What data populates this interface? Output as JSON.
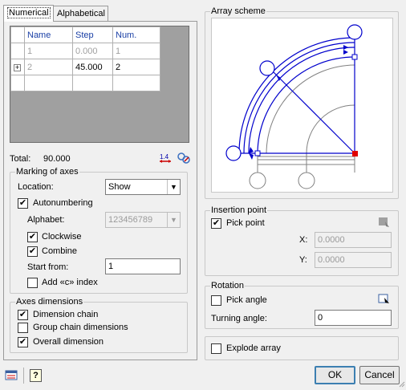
{
  "tabs": [
    {
      "label": "Numerical",
      "active": true
    },
    {
      "label": "Alphabetical",
      "active": false
    }
  ],
  "grid": {
    "headers": [
      "Name",
      "Step",
      "Num."
    ],
    "rows": [
      {
        "expander": "",
        "name": "1",
        "step": "0.000",
        "num": "1",
        "disabled": true
      },
      {
        "expander": "+",
        "name": "2",
        "step": "45.000",
        "num": "2",
        "disabled": false
      },
      {
        "expander": "",
        "name": "",
        "step": "",
        "num": "",
        "disabled": false
      }
    ]
  },
  "total": {
    "label": "Total:",
    "value": "90.000"
  },
  "marking": {
    "title": "Marking of axes",
    "location_label": "Location:",
    "location_value": "Show",
    "autonumbering_label": "Autonumbering",
    "autonumbering_checked": true,
    "alphabet_label": "Alphabet:",
    "alphabet_value": "123456789",
    "clockwise_label": "Clockwise",
    "clockwise_checked": true,
    "combine_label": "Combine",
    "combine_checked": true,
    "start_from_label": "Start from:",
    "start_from_value": "1",
    "add_index_label": "Add «c» index",
    "add_index_checked": false
  },
  "axes_dimensions": {
    "title": "Axes dimensions",
    "dimension_chain_label": "Dimension chain",
    "dimension_chain_checked": true,
    "group_chain_label": "Group chain dimensions",
    "group_chain_checked": false,
    "overall_label": "Overall dimension",
    "overall_checked": true
  },
  "array_scheme": {
    "title": "Array scheme"
  },
  "insertion_point": {
    "title": "Insertion point",
    "pick_point_label": "Pick point",
    "pick_point_checked": true,
    "x_label": "X:",
    "x_value": "0.0000",
    "y_label": "Y:",
    "y_value": "0.0000"
  },
  "rotation": {
    "title": "Rotation",
    "pick_angle_label": "Pick angle",
    "pick_angle_checked": false,
    "turning_angle_label": "Turning angle:",
    "turning_angle_value": "0"
  },
  "explode": {
    "label": "Explode array",
    "checked": false
  },
  "buttons": {
    "ok": "OK",
    "cancel": "Cancel",
    "help": "?"
  },
  "icons": {
    "check_mark": "✔",
    "swap": "⇆",
    "settings": "⚙"
  },
  "colors": {
    "scheme_blue": "#0000cc",
    "scheme_red": "#e00000",
    "header_blue": "#1a3fa5"
  }
}
